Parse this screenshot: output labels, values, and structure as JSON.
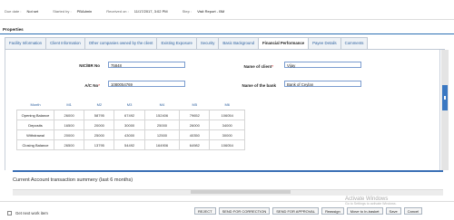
{
  "header": {
    "due_date_label": "Due date :",
    "due_date_value": "Not set",
    "started_by_label": "Started by :",
    "started_by_value": "PBAdmin",
    "received_on_label": "Received on :",
    "received_on_value": "11/17/2017, 3:02 PM",
    "step_label": "Step :",
    "step_value": "Visit Report - BM"
  },
  "properties_tab": "Properties",
  "tabs": [
    "Facility Information",
    "Client Information",
    "Other companies owned by the client",
    "Existing Exposure",
    "Security",
    "Basic Background",
    "Financial Performance",
    "Payee Details",
    "Comments"
  ],
  "active_tab": "Financial Performance",
  "form": {
    "nic_label": "NIC/BR No",
    "nic_value": "75848",
    "client_label": "Name of client",
    "client_value": "Vijay",
    "ac_label": "A/C No",
    "ac_value": "1080054769",
    "bank_label": "Name of the bank",
    "bank_value": "Bank of Ceylan",
    "required_mark": "*"
  },
  "table": {
    "headers": [
      "Month",
      "M1",
      "M2",
      "M3",
      "M4",
      "M5",
      "M6"
    ],
    "rows": [
      {
        "label": "Opening Balance",
        "values": [
          "26000",
          "58795",
          "67492",
          "152406",
          "79652",
          "106054"
        ]
      },
      {
        "label": "Deposits",
        "values": [
          "16500",
          "20000",
          "30000",
          "25000",
          "26000",
          "34000"
        ]
      },
      {
        "label": "Withdrawal",
        "values": [
          "20000",
          "25000",
          "43000",
          "12500",
          "40350",
          "30000"
        ]
      },
      {
        "label": "Closing Balance",
        "values": [
          "26500",
          "13795",
          "54492",
          "164906",
          "64982",
          "106054"
        ]
      }
    ]
  },
  "section_title": "Current Account transaction summery (last 6 months)",
  "watermark": {
    "line1": "Activate Windows",
    "line2": "Go to Settings to activate Windows."
  },
  "footer": {
    "checkbox_label": "Get next work item",
    "buttons": [
      "REJECT",
      "SEND FOR CORRECTION",
      "SEND FOR APPROVAL",
      "Reassign",
      "Move to In-basket",
      "Save",
      "Cancel"
    ]
  },
  "colors": {
    "accent": "#2b6fb3",
    "scroll_thumb": "#3a78c2"
  }
}
